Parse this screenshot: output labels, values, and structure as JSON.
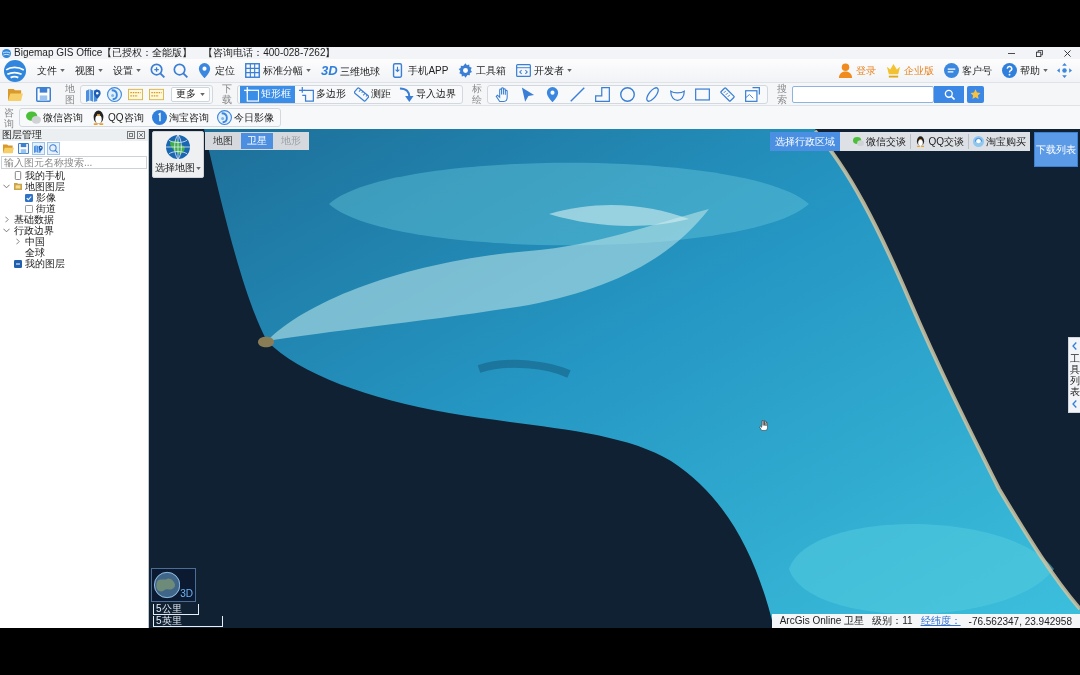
{
  "title_bar": {
    "title": "Bigemap GIS Office【已授权：全能版】",
    "hotline": "【咨询电话：400-028-7262】"
  },
  "menu_bar": {
    "menus": [
      {
        "label": "文件",
        "dropdown": true
      },
      {
        "label": "视图",
        "dropdown": true
      },
      {
        "label": "设置",
        "dropdown": true
      }
    ],
    "tools": [
      {
        "label": "定位",
        "dropdown": false
      },
      {
        "label": "标准分幅",
        "dropdown": true
      },
      {
        "label": "三维地球",
        "badge": "3D",
        "dropdown": false
      },
      {
        "label": "手机APP",
        "dropdown": false
      },
      {
        "label": "工具箱",
        "dropdown": false
      },
      {
        "label": "开发者",
        "dropdown": true
      }
    ],
    "account": [
      {
        "label": "登录",
        "emphasized": true,
        "dropdown": false
      },
      {
        "label": "企业版",
        "emphasized": true,
        "dropdown": false
      },
      {
        "label": "客户号",
        "emphasized": false,
        "dropdown": false
      },
      {
        "label": "帮助",
        "emphasized": false,
        "dropdown": true
      }
    ]
  },
  "toolbar": {
    "map_group": {
      "label": "地图",
      "more": {
        "label": "更多",
        "dropdown": true
      }
    },
    "download_group": {
      "label": "下载",
      "tools": [
        {
          "label": "矩形框",
          "selected": true
        },
        {
          "label": "多边形",
          "selected": false
        },
        {
          "label": "测距",
          "selected": false
        },
        {
          "label": "导入边界",
          "selected": false
        }
      ]
    },
    "draw_group": {
      "label": "标绘"
    },
    "search_group": {
      "label": "搜索"
    }
  },
  "consult_bar": {
    "label": "咨询",
    "items": [
      {
        "label": "微信咨询"
      },
      {
        "label": "QQ咨询"
      },
      {
        "label": "淘宝咨询"
      },
      {
        "label": "今日影像"
      }
    ]
  },
  "layer_panel": {
    "title": "图层管理",
    "search": {
      "placeholder": "输入图元名称搜索..."
    },
    "tree": [
      {
        "label": "我的手机",
        "kind": "device"
      },
      {
        "label": "地图图层",
        "kind": "folder",
        "expanded": true,
        "children": [
          {
            "label": "影像",
            "kind": "check",
            "checked": true,
            "partial": false
          },
          {
            "label": "街道",
            "kind": "check",
            "checked": false,
            "partial": false
          }
        ]
      },
      {
        "label": "基础数据",
        "kind": "group",
        "expanded": false
      },
      {
        "label": "行政边界",
        "kind": "group",
        "expanded": true,
        "children": [
          {
            "label": "中国",
            "kind": "group",
            "expanded": false
          },
          {
            "label": "全球",
            "kind": "text"
          }
        ]
      },
      {
        "label": "我的图层",
        "kind": "check",
        "checked": true,
        "partial": true
      }
    ]
  },
  "map": {
    "picker": {
      "label": "选择地图",
      "dropdown": true
    },
    "tabs": [
      {
        "label": "地图",
        "selected": false,
        "disabled": false
      },
      {
        "label": "卫星",
        "selected": true,
        "disabled": false
      },
      {
        "label": "地形",
        "selected": false,
        "disabled": true
      }
    ],
    "region_button": "选择行政区域",
    "contacts": [
      {
        "label": "微信交谈"
      },
      {
        "label": "QQ交谈"
      },
      {
        "label": "淘宝购买"
      }
    ],
    "download_list": "下载列表",
    "side_tab": "工具列表",
    "globe_button": "3D",
    "scale": [
      "5公里",
      "5英里"
    ],
    "status": {
      "source": "ArcGis Online 卫星",
      "zoom_label": "级别：",
      "zoom_value": "11",
      "coords_label": "经纬度：",
      "coords": "-76.562347, 23.942958"
    }
  }
}
